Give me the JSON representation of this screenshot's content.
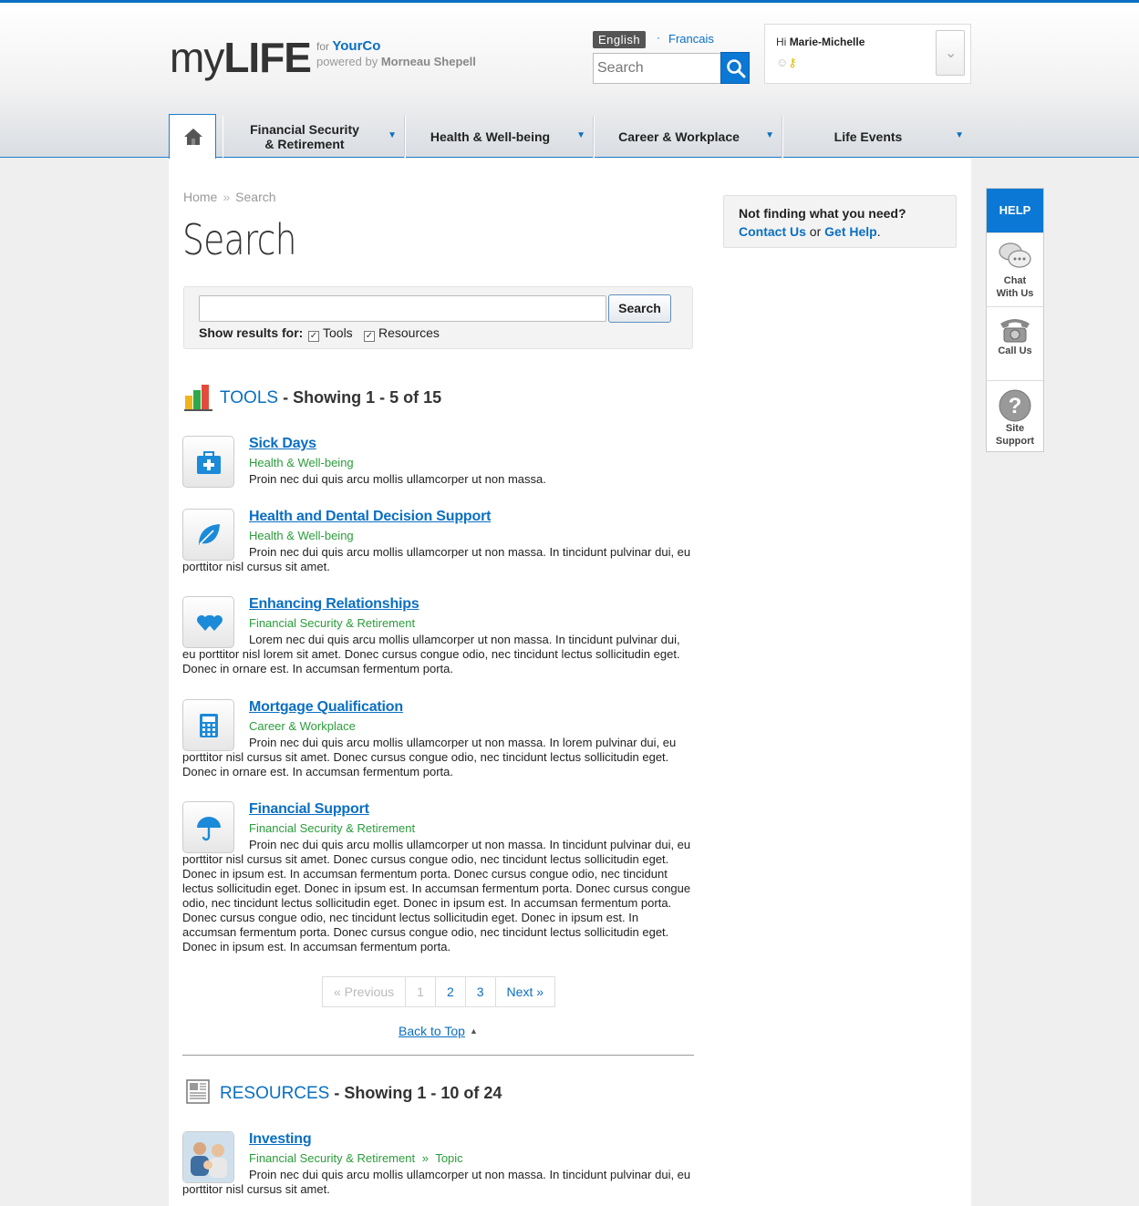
{
  "header": {
    "logo_my": "my",
    "logo_life": "LIFE",
    "for_label": "for",
    "client": "YourCo",
    "powered_label": "powered by",
    "powered_by": "Morneau Shepell",
    "lang_active": "English",
    "lang_other": "Francais",
    "search_placeholder": "Search",
    "user_greeting": "Hi",
    "user_name": "Marie-Michelle"
  },
  "nav": {
    "home_icon": "home-icon",
    "items": [
      {
        "label_line1": "Financial Security",
        "label_line2": "& Retirement"
      },
      {
        "label_line1": "Health & Well-being",
        "label_line2": ""
      },
      {
        "label_line1": "Career & Workplace",
        "label_line2": ""
      },
      {
        "label_line1": "Life Events",
        "label_line2": ""
      }
    ]
  },
  "breadcrumb": {
    "home": "Home",
    "sep": "»",
    "current": "Search"
  },
  "page_title": "Search",
  "search_box": {
    "value": "",
    "button": "Search",
    "show_label": "Show results for:",
    "filters": [
      {
        "label": "Tools",
        "checked": true
      },
      {
        "label": "Resources",
        "checked": true
      }
    ]
  },
  "tools": {
    "title": "TOOLS",
    "showing": "- Showing 1 - 5 of 15",
    "results": [
      {
        "icon": "first-aid-icon",
        "title": "Sick Days",
        "category": "Health & Well-being",
        "desc": "Proin nec dui quis arcu mollis ullamcorper ut non massa."
      },
      {
        "icon": "leaf-icon",
        "title": "Health and Dental Decision Support",
        "category": "Health & Well-being",
        "desc": "Proin nec dui quis arcu mollis ullamcorper ut non massa. In tincidunt pulvinar dui, eu porttitor nisl cursus sit amet."
      },
      {
        "icon": "hearts-icon",
        "title": "Enhancing Relationships",
        "category": "Financial Security & Retirement",
        "desc": "Lorem nec dui quis arcu mollis ullamcorper ut non massa. In tincidunt pulvinar dui, eu porttitor nisl lorem sit amet. Donec cursus congue odio, nec tincidunt lectus sollicitudin eget. Donec in ornare est. In accumsan fermentum porta."
      },
      {
        "icon": "calculator-icon",
        "title": "Mortgage Qualification",
        "category": "Career & Workplace",
        "desc": "Proin nec dui quis arcu mollis ullamcorper ut non massa. In lorem pulvinar dui, eu porttitor nisl cursus sit amet. Donec cursus congue odio, nec tincidunt lectus sollicitudin eget. Donec in ornare est. In accumsan fermentum porta."
      },
      {
        "icon": "umbrella-icon",
        "title": "Financial Support",
        "category": "Financial Security & Retirement",
        "desc": "Proin nec dui quis arcu mollis ullamcorper ut non massa. In tincidunt pulvinar dui, eu porttitor nisl cursus sit amet. Donec cursus congue odio, nec tincidunt lectus sollicitudin eget. Donec in ipsum est. In accumsan fermentum porta. Donec cursus congue odio, nec tincidunt lectus sollicitudin eget. Donec in ipsum est. In accumsan fermentum porta. Donec cursus congue odio, nec tincidunt lectus sollicitudin eget. Donec in ipsum est. In accumsan fermentum porta. Donec cursus congue odio, nec tincidunt lectus sollicitudin eget. Donec in ipsum est. In accumsan fermentum porta. Donec cursus congue odio, nec tincidunt lectus sollicitudin eget. Donec in ipsum est. In accumsan fermentum porta."
      }
    ]
  },
  "pager": {
    "previous": "« Previous",
    "pages": [
      "1",
      "2",
      "3"
    ],
    "next": "Next »",
    "current_page": 1
  },
  "back_to_top": "Back to Top",
  "resources": {
    "title": "RESOURCES",
    "showing": "- Showing 1 - 10 of 24",
    "results": [
      {
        "icon": "family-photo",
        "title": "Investing",
        "category": "Financial Security & Retirement",
        "sep": "»",
        "type": "Topic",
        "desc": "Proin nec dui quis arcu mollis ullamcorper ut non massa. In tincidunt pulvinar dui, eu porttitor nisl cursus sit amet."
      }
    ]
  },
  "sidebar": {
    "question": "Not finding what you need?",
    "contact": "Contact Us",
    "or": "or",
    "help": "Get Help",
    "period": "."
  },
  "help_panel": {
    "header": "HELP",
    "items": [
      {
        "icon": "chat-icon",
        "label_line1": "Chat",
        "label_line2": "With Us"
      },
      {
        "icon": "phone-icon",
        "label_line1": "Call Us",
        "label_line2": ""
      },
      {
        "icon": "question-icon",
        "label_line1": "Site",
        "label_line2": "Support"
      }
    ]
  },
  "colors": {
    "accent": "#0a6fc2",
    "category_green": "#2a9d3a",
    "help_blue": "#0a78d4"
  }
}
